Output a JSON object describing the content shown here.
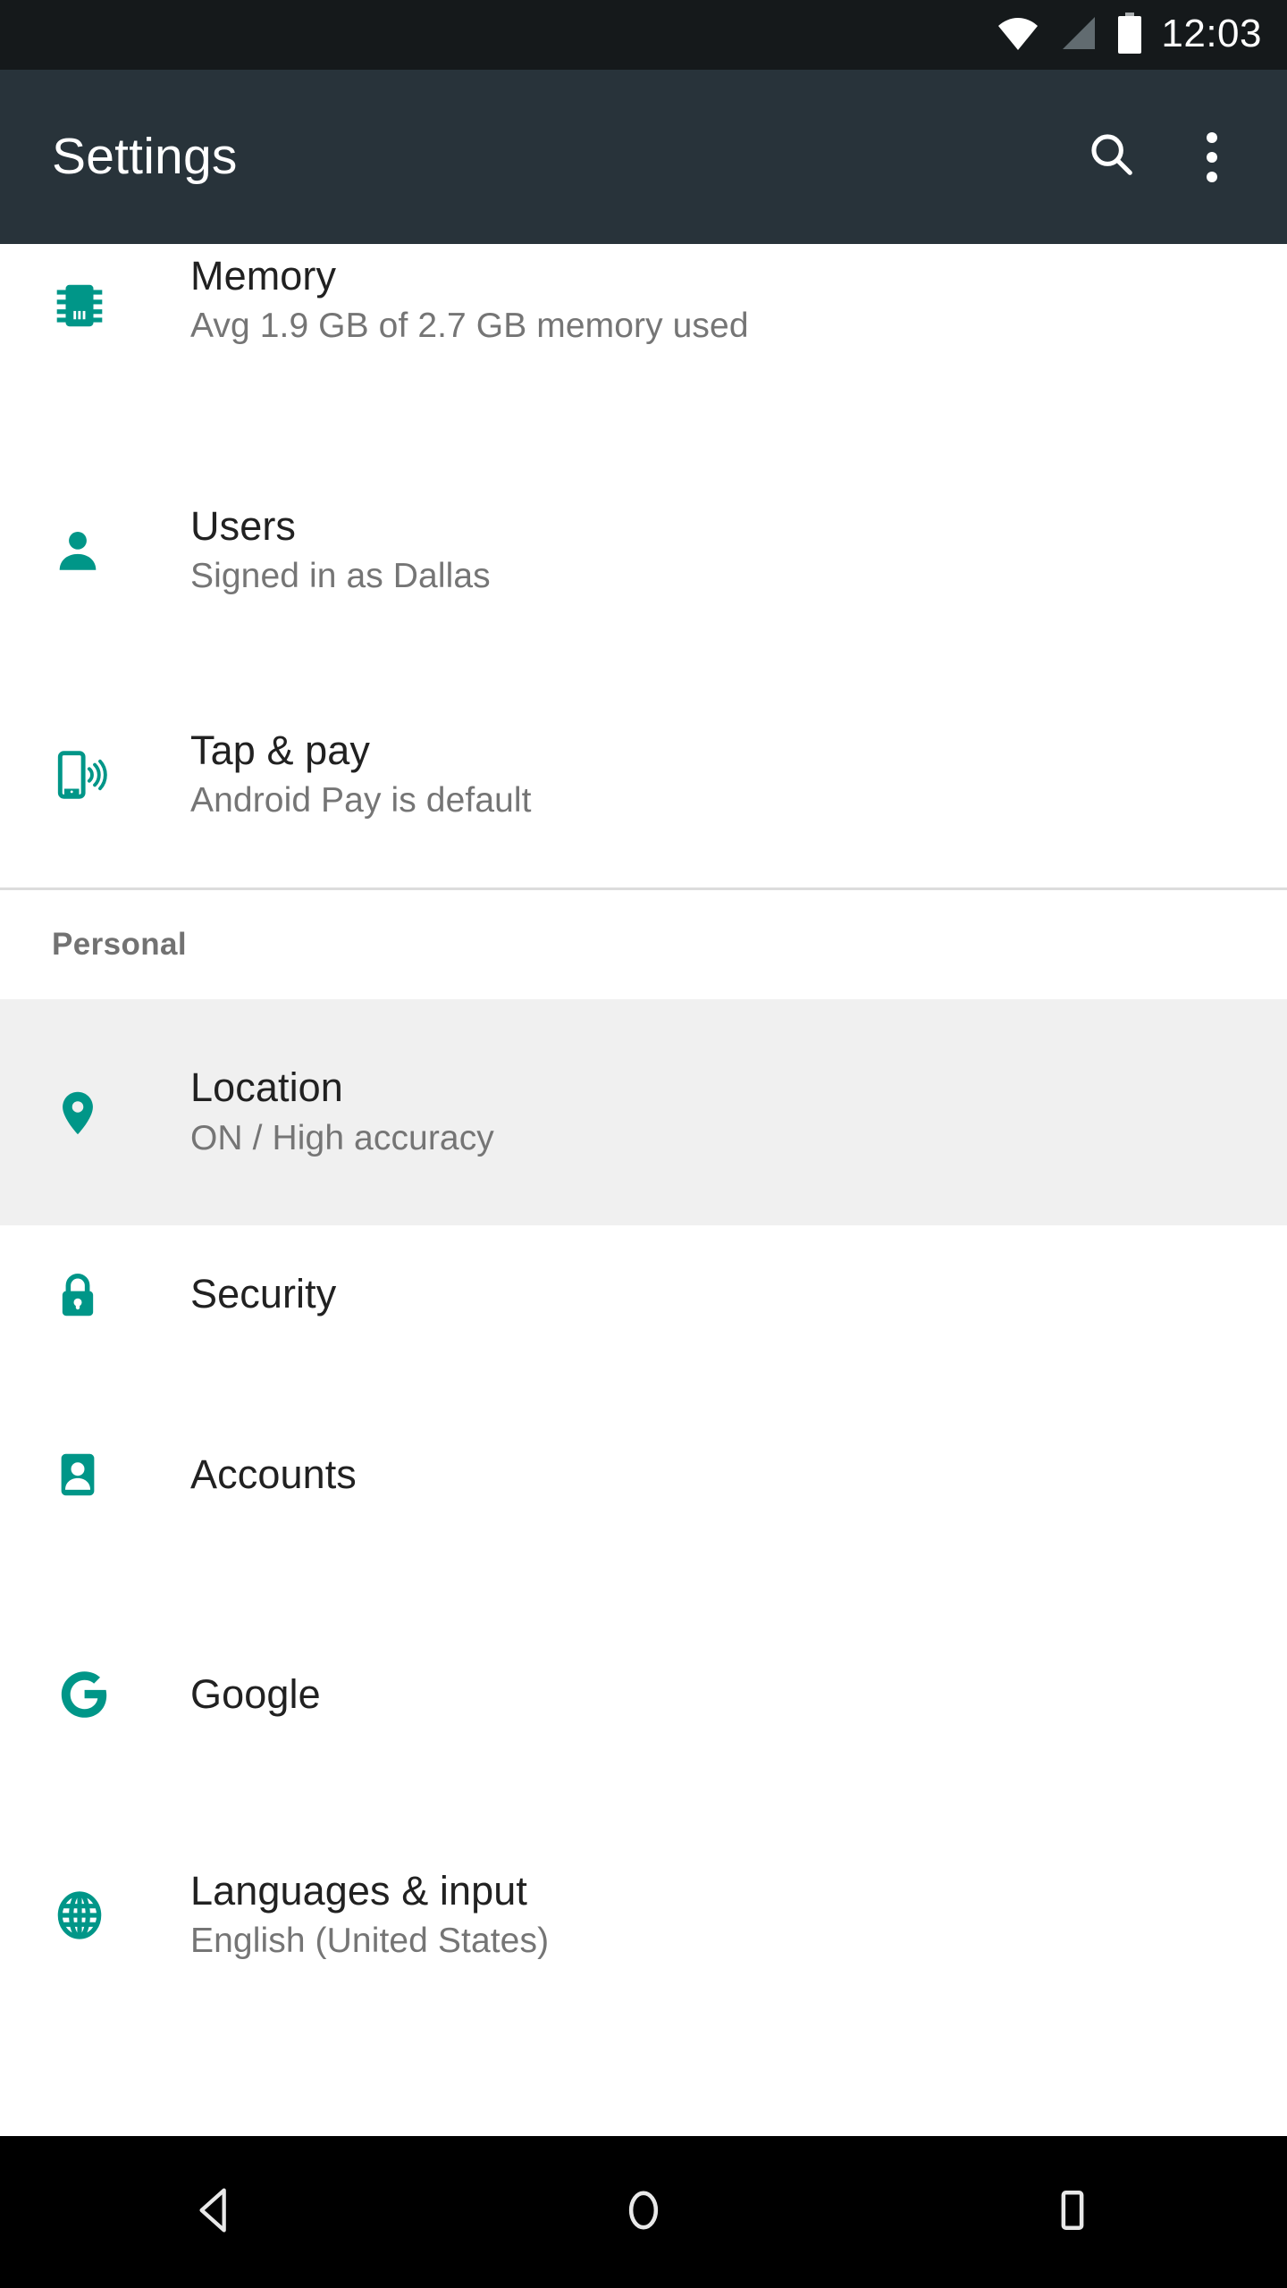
{
  "status_bar": {
    "time": "12:03",
    "icons": [
      "wifi-icon",
      "cell-signal-icon",
      "battery-icon"
    ]
  },
  "app_bar": {
    "title": "Settings",
    "actions": [
      {
        "name": "search-icon",
        "label": "Search"
      },
      {
        "name": "overflow-menu-icon",
        "label": "More options"
      }
    ]
  },
  "colors": {
    "accent_teal": "#009688",
    "app_bar": "#28333a",
    "status_bar": "#15191b",
    "selected_row": "#f0f0f0",
    "title_text": "#212121",
    "subtitle_text": "#757575",
    "section_header_text": "#727272",
    "divider": "#dcdcdc",
    "nav_bar": "#000000"
  },
  "list": {
    "top_items": [
      {
        "icon": "memory-chip-icon",
        "title": "Memory",
        "subtitle": "Avg 1.9 GB of 2.7 GB memory used",
        "selected": false
      },
      {
        "icon": "user-person-icon",
        "title": "Users",
        "subtitle": "Signed in as Dallas",
        "selected": false
      },
      {
        "icon": "nfc-tap-pay-icon",
        "title": "Tap & pay",
        "subtitle": "Android Pay is default",
        "selected": false
      }
    ],
    "section": {
      "title": "Personal"
    },
    "personal_items": [
      {
        "icon": "location-pin-icon",
        "title": "Location",
        "subtitle": "ON / High accuracy",
        "selected": true
      },
      {
        "icon": "lock-icon",
        "title": "Security",
        "subtitle": "",
        "selected": false
      },
      {
        "icon": "accounts-badge-icon",
        "title": "Accounts",
        "subtitle": "",
        "selected": false
      },
      {
        "icon": "google-g-icon",
        "title": "Google",
        "subtitle": "",
        "selected": false
      },
      {
        "icon": "globe-language-icon",
        "title": "Languages & input",
        "subtitle": "English (United States)",
        "selected": false
      }
    ]
  },
  "nav_bar": {
    "buttons": [
      {
        "name": "nav-back-button",
        "label": "Back"
      },
      {
        "name": "nav-home-button",
        "label": "Home"
      },
      {
        "name": "nav-recents-button",
        "label": "Recents"
      }
    ]
  }
}
